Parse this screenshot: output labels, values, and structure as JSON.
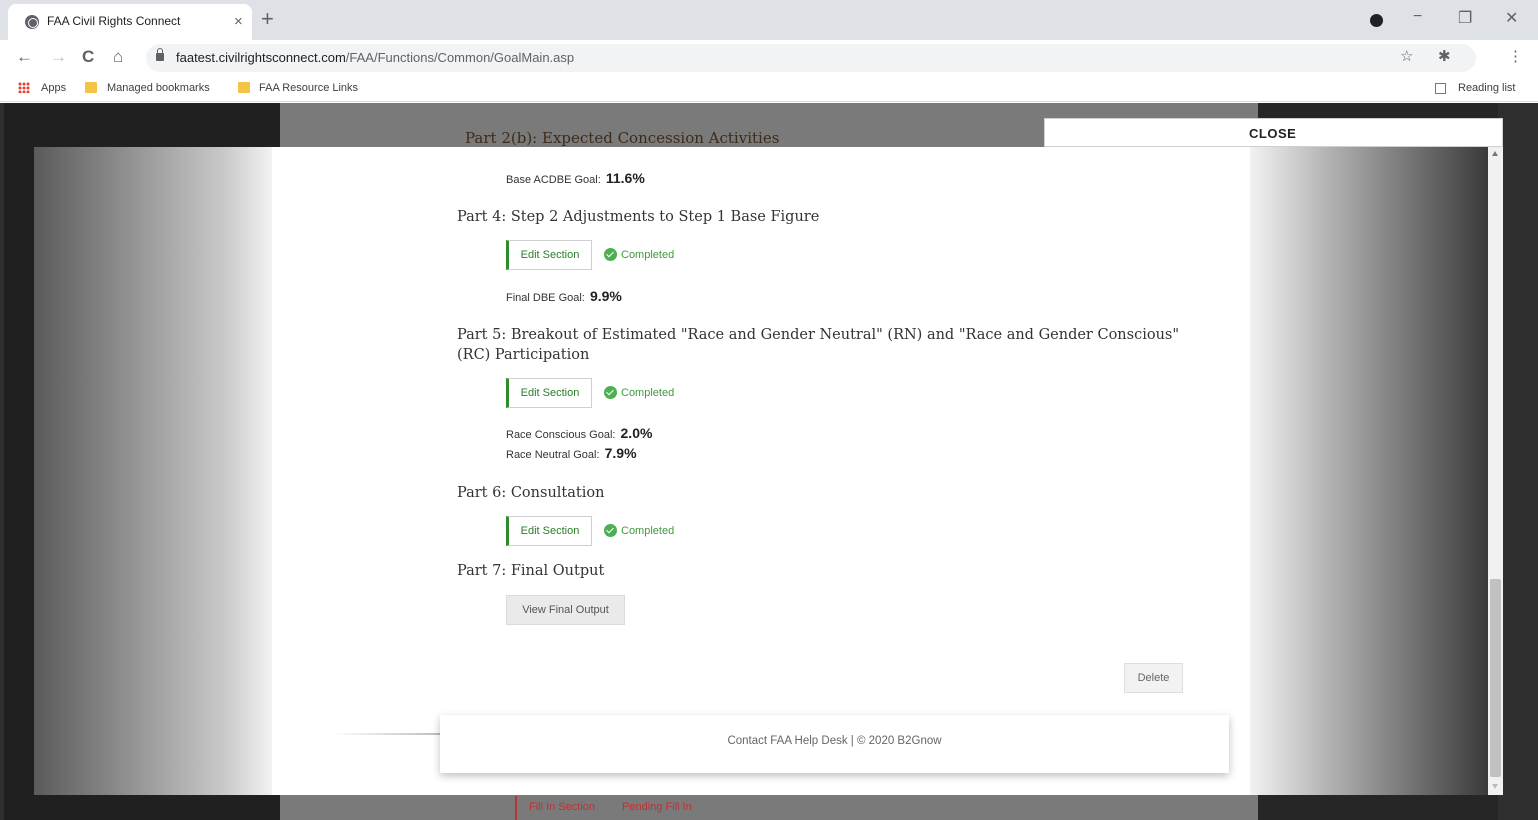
{
  "browser": {
    "tab_title": "FAA Civil Rights Connect",
    "tab_close": "×",
    "new_tab": "+",
    "url_host": "faatest.civilrightsconnect.com",
    "url_path": "/FAA/Functions/Common/GoalMain.asp",
    "bookmarks": {
      "apps": "Apps",
      "managed": "Managed bookmarks",
      "faa_links": "FAA Resource Links",
      "reading_list": "Reading list"
    },
    "icons": {
      "back": "←",
      "forward": "→",
      "reload": "C",
      "home": "⌂",
      "star": "☆",
      "extensions": "✱",
      "menu": "⋮",
      "minimize": "−",
      "maximize": "❐",
      "close": "✕"
    }
  },
  "background": {
    "partial_heading": "Part 2(b): Expected Concession Activities",
    "fill_in_section": "Fill In Section",
    "pending_fill_in": "Pending Fill In"
  },
  "modal": {
    "close_label": "CLOSE",
    "base_acdbe": {
      "label": "Base ACDBE Goal:",
      "value": "11.6%"
    },
    "part4": {
      "heading": "Part 4: Step 2 Adjustments to Step 1 Base Figure",
      "edit_label": "Edit Section",
      "status": "Completed",
      "final_dbe": {
        "label": "Final DBE Goal:",
        "value": "9.9%"
      }
    },
    "part5": {
      "heading": "Part 5: Breakout of Estimated \"Race and Gender Neutral\" (RN) and \"Race and Gender Conscious\" (RC) Participation",
      "edit_label": "Edit Section",
      "status": "Completed",
      "race_conscious": {
        "label": "Race Conscious Goal:",
        "value": "2.0%"
      },
      "race_neutral": {
        "label": "Race Neutral Goal:",
        "value": "7.9%"
      }
    },
    "part6": {
      "heading": "Part 6: Consultation",
      "edit_label": "Edit Section",
      "status": "Completed"
    },
    "part7": {
      "heading": "Part 7: Final Output",
      "view_label": "View Final Output"
    },
    "delete_label": "Delete",
    "footer": "Contact FAA Help Desk | © 2020 B2Gnow"
  }
}
